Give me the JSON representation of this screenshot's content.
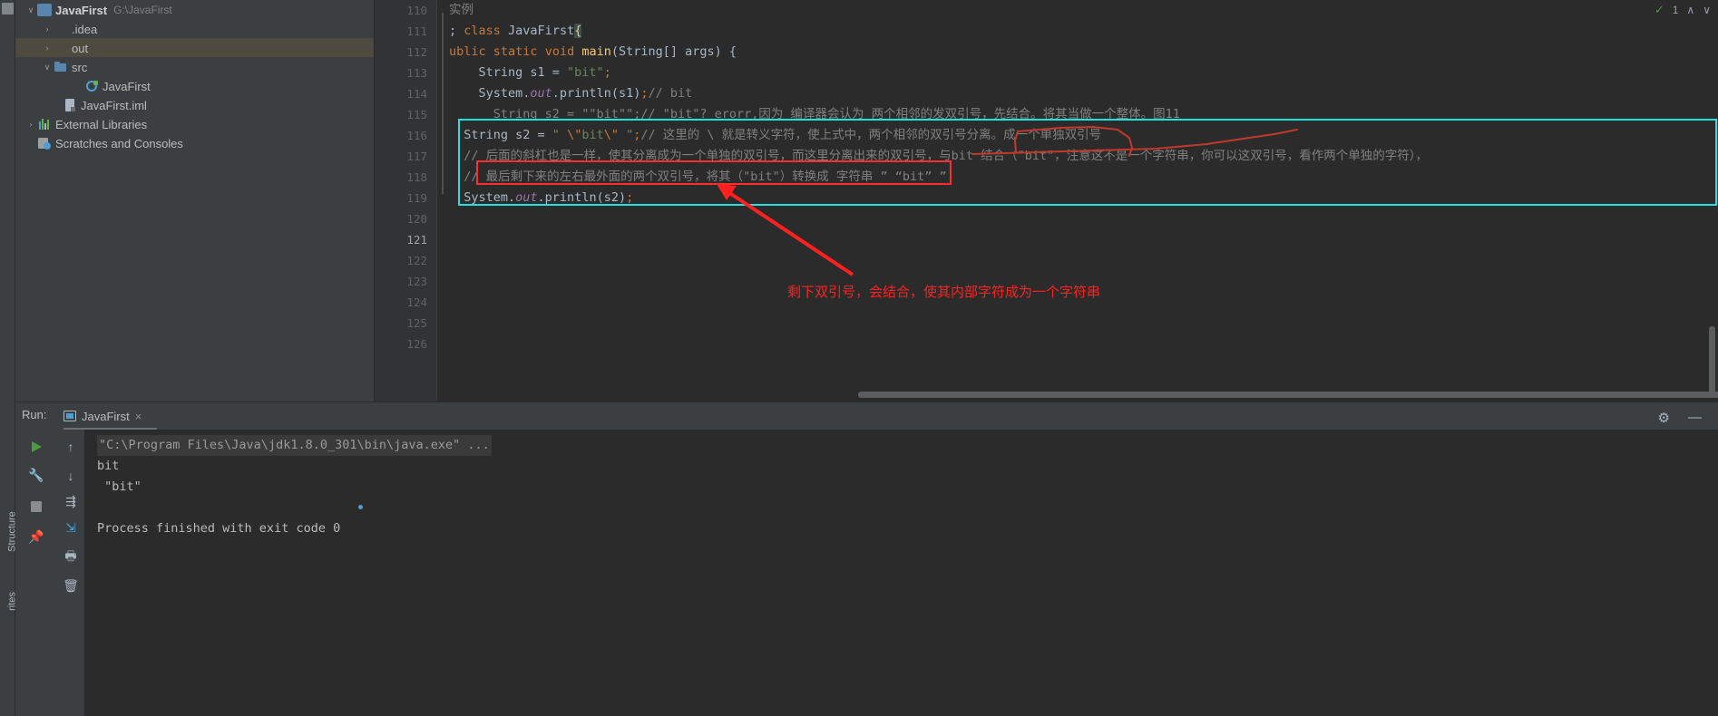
{
  "project_tree": {
    "items": [
      {
        "label": "JavaFirst",
        "path": "G:\\JavaFirst",
        "arrow": "∨",
        "icon": "module-icon",
        "indent": 0,
        "selected": false,
        "bold": true
      },
      {
        "label": ".idea",
        "path": "",
        "arrow": "›",
        "icon": "folder-icon",
        "indent": 1,
        "selected": false,
        "bold": false
      },
      {
        "label": "out",
        "path": "",
        "arrow": "›",
        "icon": "folder-out-icon",
        "indent": 1,
        "selected": true,
        "bold": false
      },
      {
        "label": "src",
        "path": "",
        "arrow": "∨",
        "icon": "folder-src-icon",
        "indent": 1,
        "selected": false,
        "bold": false
      },
      {
        "label": "JavaFirst",
        "path": "",
        "arrow": "",
        "icon": "java-class-icon",
        "indent": 2,
        "selected": false,
        "bold": false
      },
      {
        "label": "JavaFirst.iml",
        "path": "",
        "arrow": "",
        "icon": "iml-file-icon",
        "indent": 1,
        "selected": false,
        "bold": false
      },
      {
        "label": "External Libraries",
        "path": "",
        "arrow": "›",
        "icon": "libraries-icon",
        "indent": 0,
        "selected": false,
        "bold": false
      },
      {
        "label": "Scratches and Consoles",
        "path": "",
        "arrow": "",
        "icon": "scratches-icon",
        "indent": 0,
        "selected": false,
        "bold": false
      }
    ]
  },
  "edge_strip": {
    "left_labels": [
      "Structure",
      "rites"
    ]
  },
  "editor": {
    "tab_hint": "实例",
    "line_numbers": [
      "110",
      "111",
      "112",
      "113",
      "114",
      "115",
      "116",
      "117",
      "118",
      "119",
      "120",
      "121",
      "122",
      "123",
      "124",
      "125",
      "126"
    ],
    "current_line": "121",
    "run_markers": [
      "111",
      "112"
    ],
    "status_icons": [
      "✓",
      "1",
      "∧",
      "∨"
    ],
    "lines": [
      {
        "num": "110",
        "segments": [
          {
            "t": "实例",
            "c": "cmt"
          }
        ]
      },
      {
        "num": "111",
        "segments": [
          {
            "t": "; ",
            "c": "plain"
          },
          {
            "t": "class ",
            "c": "kw"
          },
          {
            "t": "JavaFirst",
            "c": "plain"
          },
          {
            "t": "{",
            "c": "caret-brace"
          }
        ]
      },
      {
        "num": "112",
        "segments": [
          {
            "t": "ublic ",
            "c": "kw"
          },
          {
            "t": "static ",
            "c": "kw"
          },
          {
            "t": "void ",
            "c": "kw"
          },
          {
            "t": "main",
            "c": "plain"
          },
          {
            "t": "(String[] args) {",
            "c": "plain"
          }
        ]
      },
      {
        "num": "113",
        "segments": [
          {
            "t": "    String s1 = ",
            "c": "plain"
          },
          {
            "t": "\"bit\"",
            "c": "str"
          },
          {
            "t": ";",
            "c": "semi"
          }
        ]
      },
      {
        "num": "114",
        "segments": [
          {
            "t": "    System.",
            "c": "plain"
          },
          {
            "t": "out",
            "c": "fld"
          },
          {
            "t": ".println(s1)",
            "c": "plain"
          },
          {
            "t": ";",
            "c": "semi"
          },
          {
            "t": "// bit",
            "c": "cmt"
          }
        ]
      },
      {
        "num": "115",
        "segments": [
          {
            "t": "      String s2 = \"\"bit\"\";// \"bit\"? erorr,因为 编译器会认为 两个相邻的发双引号，先结合。将其当做一个整体。图11",
            "c": "cmt"
          }
        ]
      },
      {
        "num": "116",
        "segments": [
          {
            "t": "  String s2 = ",
            "c": "plain"
          },
          {
            "t": "\" ",
            "c": "str"
          },
          {
            "t": "\\\"",
            "c": "esc"
          },
          {
            "t": "bit",
            "c": "str"
          },
          {
            "t": "\\\"",
            "c": "esc"
          },
          {
            "t": " \"",
            "c": "str"
          },
          {
            "t": ";",
            "c": "semi"
          },
          {
            "t": "// 这里的 \\ 就是转义字符，使上式中，两个相邻的双引号分离。成一个单独双引号",
            "c": "cmt"
          }
        ]
      },
      {
        "num": "117",
        "segments": [
          {
            "t": "  // 后面的斜杠也是一样，使其分离成为一个单独的双引号，而这里分离出来的双引号，与bit 结合（\"bit\"，注意这不是一个字符串，你可以这双引号，看作两个单独的字符），",
            "c": "cmt"
          }
        ]
      },
      {
        "num": "118",
        "segments": [
          {
            "t": "  // 最后剩下来的左右最外面的两个双引号，将其（\"bit\"）转换成 字符串 ” “bit” ”",
            "c": "cmt"
          }
        ]
      },
      {
        "num": "119",
        "segments": [
          {
            "t": "  System.",
            "c": "plain"
          },
          {
            "t": "out",
            "c": "fld"
          },
          {
            "t": ".println(s2)",
            "c": "plain"
          },
          {
            "t": ";",
            "c": "semi"
          }
        ]
      },
      {
        "num": "120",
        "segments": []
      },
      {
        "num": "121",
        "segments": []
      },
      {
        "num": "122",
        "segments": []
      },
      {
        "num": "123",
        "segments": []
      },
      {
        "num": "124",
        "segments": []
      },
      {
        "num": "125",
        "segments": []
      },
      {
        "num": "126",
        "segments": []
      }
    ]
  },
  "annotations": {
    "note_text": "剩下双引号，会结合，使其内部字符成为一个字符串",
    "cyan_color": "#24e0e0",
    "red_color": "#ff2020"
  },
  "run_panel": {
    "title": "Run:",
    "tab_label": "JavaFirst",
    "tab_close": "×",
    "settings_icon": "⚙",
    "minimize_icon": "—",
    "toolbar_primary": [
      "run-icon",
      "wrench-icon",
      "stop-icon",
      "pin-icon"
    ],
    "toolbar_secondary": [
      "scroll-up-icon",
      "scroll-down-icon",
      "soft-wrap-icon",
      "scroll-end-icon",
      "print-icon",
      "trash-icon"
    ],
    "console_lines": [
      {
        "text": "\"C:\\Program Files\\Java\\jdk1.8.0_301\\bin\\java.exe\" ...",
        "style": "cmd"
      },
      {
        "text": "bit",
        "style": "out"
      },
      {
        "text": " \"bit\"",
        "style": "out"
      },
      {
        "text": "",
        "style": "out"
      },
      {
        "text": "Process finished with exit code 0",
        "style": "out"
      }
    ]
  }
}
